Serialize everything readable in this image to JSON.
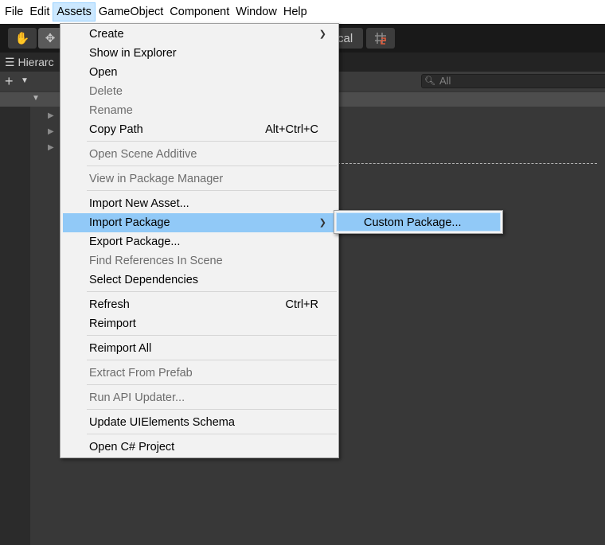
{
  "menubar": {
    "items": [
      "File",
      "Edit",
      "Assets",
      "GameObject",
      "Component",
      "Window",
      "Help"
    ],
    "active": "Assets"
  },
  "toolbar": {
    "hand_icon": "hand-icon",
    "move_icon": "move-icon",
    "pivot_label": "cal",
    "grid_icon": "grid-snap-icon"
  },
  "hierarchy": {
    "tab_label": "Hierarc",
    "add_icon": "plus-icon",
    "search_placeholder": "All"
  },
  "assets_menu": {
    "items": [
      {
        "label": "Create",
        "shortcut": "",
        "submenu": true,
        "disabled": false
      },
      {
        "label": "Show in Explorer",
        "shortcut": "",
        "submenu": false,
        "disabled": false
      },
      {
        "label": "Open",
        "shortcut": "",
        "submenu": false,
        "disabled": false
      },
      {
        "label": "Delete",
        "shortcut": "",
        "submenu": false,
        "disabled": true
      },
      {
        "label": "Rename",
        "shortcut": "",
        "submenu": false,
        "disabled": true
      },
      {
        "label": "Copy Path",
        "shortcut": "Alt+Ctrl+C",
        "submenu": false,
        "disabled": false
      },
      {
        "label": "Open Scene Additive",
        "shortcut": "",
        "submenu": false,
        "disabled": true
      },
      {
        "label": "View in Package Manager",
        "shortcut": "",
        "submenu": false,
        "disabled": true
      },
      {
        "label": "Import New Asset...",
        "shortcut": "",
        "submenu": false,
        "disabled": false
      },
      {
        "label": "Import Package",
        "shortcut": "",
        "submenu": true,
        "disabled": false,
        "highlighted": true
      },
      {
        "label": "Export Package...",
        "shortcut": "",
        "submenu": false,
        "disabled": false
      },
      {
        "label": "Find References In Scene",
        "shortcut": "",
        "submenu": false,
        "disabled": true
      },
      {
        "label": "Select Dependencies",
        "shortcut": "",
        "submenu": false,
        "disabled": false
      },
      {
        "label": "Refresh",
        "shortcut": "Ctrl+R",
        "submenu": false,
        "disabled": false
      },
      {
        "label": "Reimport",
        "shortcut": "",
        "submenu": false,
        "disabled": false
      },
      {
        "label": "Reimport All",
        "shortcut": "",
        "submenu": false,
        "disabled": false
      },
      {
        "label": "Extract From Prefab",
        "shortcut": "",
        "submenu": false,
        "disabled": true
      },
      {
        "label": "Run API Updater...",
        "shortcut": "",
        "submenu": false,
        "disabled": true
      },
      {
        "label": "Update UIElements Schema",
        "shortcut": "",
        "submenu": false,
        "disabled": false
      },
      {
        "label": "Open C# Project",
        "shortcut": "",
        "submenu": false,
        "disabled": false
      }
    ]
  },
  "import_package_submenu": {
    "items": [
      "Custom Package..."
    ]
  },
  "colors": {
    "highlight": "#91c9f7",
    "menu_bg": "#f2f2f2",
    "disabled_text": "#6d6d6d",
    "editor_bg": "#383838"
  }
}
